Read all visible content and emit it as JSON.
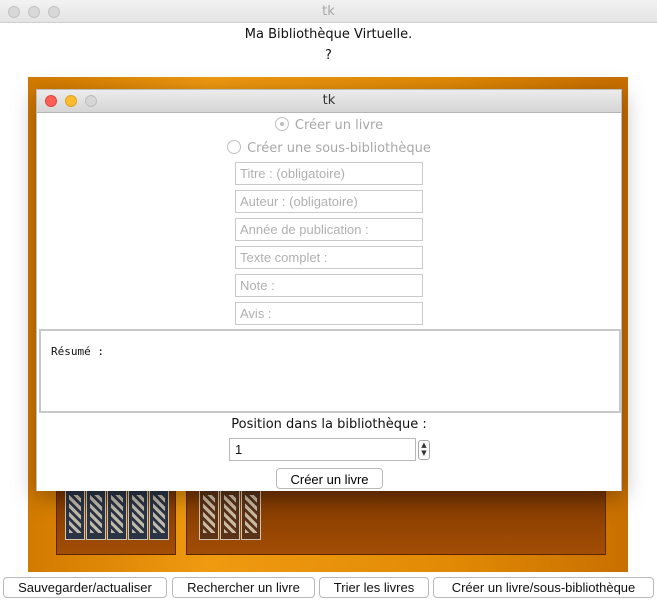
{
  "main_window": {
    "title": "tk",
    "heading": "Ma Bibliothèque Virtuelle.",
    "subheading": "?"
  },
  "toolbar": {
    "save_label": "Sauvegarder/actualiser",
    "search_label": "Rechercher un livre",
    "sort_label": "Trier les livres",
    "create_label": "Créer un livre/sous-bibliothèque"
  },
  "dialog": {
    "title": "tk",
    "radio_book": "Créer un livre",
    "radio_sublibrary": "Créer une sous-bibliothèque",
    "fields": {
      "title": "Titre : (obligatoire)",
      "author": "Auteur : (obligatoire)",
      "year": "Année de publication :",
      "fulltext": "Texte complet :",
      "note": "Note :",
      "review": "Avis :"
    },
    "summary_label": "Résumé :",
    "position_label": "Position dans la bibliothèque :",
    "position_value": "1",
    "submit_label": "Créer un livre"
  },
  "colors": {
    "shelf": "#e88e08",
    "close": "#fc5f57",
    "minimize": "#fdbc2e"
  }
}
